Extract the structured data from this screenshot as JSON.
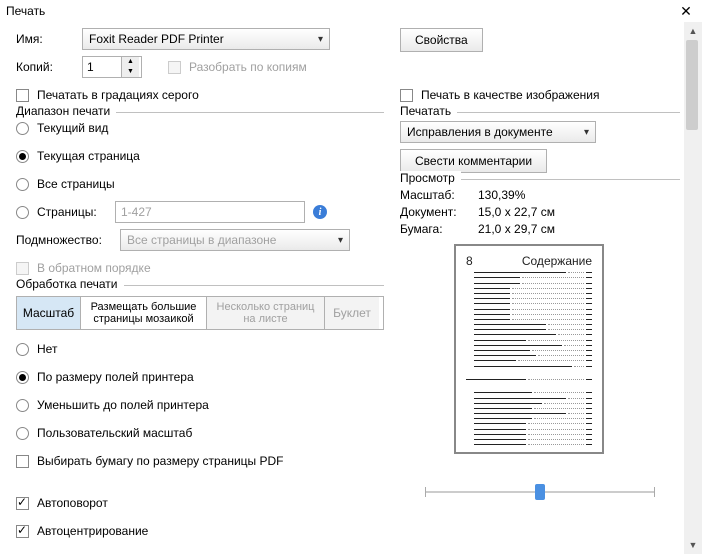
{
  "title": "Печать",
  "left": {
    "name_label": "Имя:",
    "printer_name": "Foxit Reader PDF Printer",
    "properties_btn": "Свойства",
    "copies_label": "Копий:",
    "copies_value": "1",
    "collate_label": "Разобрать по копиям",
    "grayscale_label": "Печатать в градациях серого",
    "print_as_image_label": "Печать в качестве изображения",
    "range_title": "Диапазон печати",
    "range_current_view": "Текущий вид",
    "range_current_page": "Текущая страница",
    "range_all_pages": "Все страницы",
    "range_pages": "Страницы:",
    "pages_value": "1-427",
    "subset_label": "Подмножество:",
    "subset_value": "Все страницы в диапазоне",
    "reverse_label": "В обратном порядке",
    "handling_title": "Обработка печати",
    "tab_scale": "Масштаб",
    "tab_tile": "Размещать большие страницы мозаикой",
    "tab_multiple": "Несколько страниц на листе",
    "tab_booklet": "Буклет",
    "scale_none": "Нет",
    "scale_fit": "По размеру полей принтера",
    "scale_reduce": "Уменьшить до полей принтера",
    "scale_custom": "Пользовательский масштаб",
    "choose_paper": "Выбирать бумагу по размеру страницы PDF",
    "auto_rotate": "Автоповорот",
    "auto_center": "Автоцентрирование"
  },
  "right": {
    "print_title": "Печатать",
    "print_what": "Исправления в документе",
    "summarize_btn": "Свести комментарии",
    "preview_title": "Просмотр",
    "zoom_label": "Масштаб:",
    "zoom_value": "130,39%",
    "doc_label": "Документ:",
    "doc_value": "15,0 x 22,7 см",
    "paper_label": "Бумага:",
    "paper_value": "21,0 x 29,7 см",
    "preview_page_num": "8",
    "preview_page_head": "Содержание"
  }
}
